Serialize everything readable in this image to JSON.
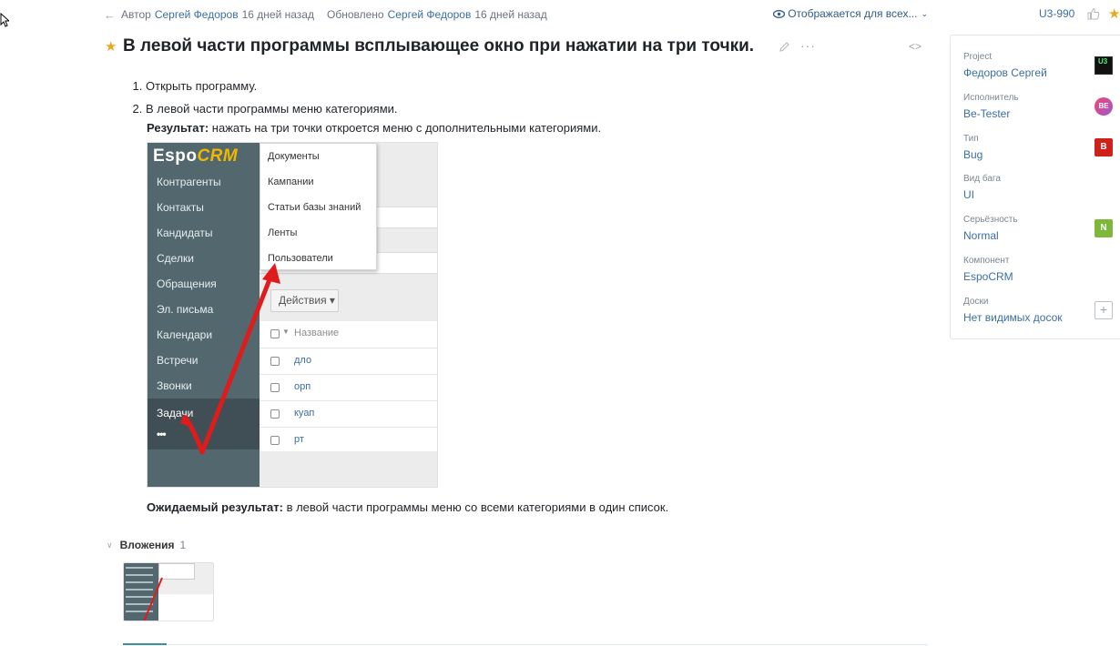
{
  "meta": {
    "author_label": "Автор",
    "author_name": "Сергей Федоров",
    "author_time": "16 дней назад",
    "updated_label": "Обновлено",
    "updated_name": "Сергей Федоров",
    "updated_time": "16 дней назад",
    "visibility": "Отображается для всех...",
    "issue_id": "U3-990"
  },
  "title": "В левой части программы всплывающее окно при нажатии на три точки.",
  "description": {
    "steps": [
      "Открыть программу.",
      "В левой части программы меню категориями."
    ],
    "result_label": "Результат:",
    "result_text": " нажать на три точки откроется меню с дополнительными категориями.",
    "expected_label": "Ожидаемый результат:",
    "expected_text": " в левой части программы меню со всеми категориями в один список."
  },
  "screenshot": {
    "logo_espo": "Espo",
    "logo_crm": "CRM",
    "sidebar_items": [
      "Контрагенты",
      "Контакты",
      "Кандидаты",
      "Сделки",
      "Обращения",
      "Эл. письма",
      "Календари",
      "Встречи",
      "Звонки"
    ],
    "active_item": "Задачи",
    "more_dots": "•••",
    "menu_items": [
      "Документы",
      "Кампании",
      "Статьи базы знаний",
      "Ленты",
      "Пользователи"
    ],
    "actions_button": "Действия ▾",
    "table_header": "Название",
    "table_rows": [
      "дло",
      "орп",
      "куап",
      "рт"
    ]
  },
  "panel": {
    "fields": [
      {
        "label": "Project",
        "value": "Федоров Сергей",
        "badge": "U3"
      },
      {
        "label": "Исполнитель",
        "value": "Be-Tester",
        "badge": "BE"
      },
      {
        "label": "Тип",
        "value": "Bug",
        "badge": "B"
      },
      {
        "label": "Вид бага",
        "value": "UI",
        "badge": ""
      },
      {
        "label": "Серьёзность",
        "value": "Normal",
        "badge": "N"
      },
      {
        "label": "Компонент",
        "value": "EspoCRM",
        "badge": ""
      },
      {
        "label": "Доски",
        "value": "Нет видимых досок",
        "badge": "+"
      }
    ]
  },
  "attachments": {
    "label": "Вложения",
    "count": "1"
  },
  "colors": {
    "link": "#3a6ea5",
    "star": "#e8a91c",
    "crm_sidebar": "#53686e",
    "arrow": "#e01b1b"
  }
}
